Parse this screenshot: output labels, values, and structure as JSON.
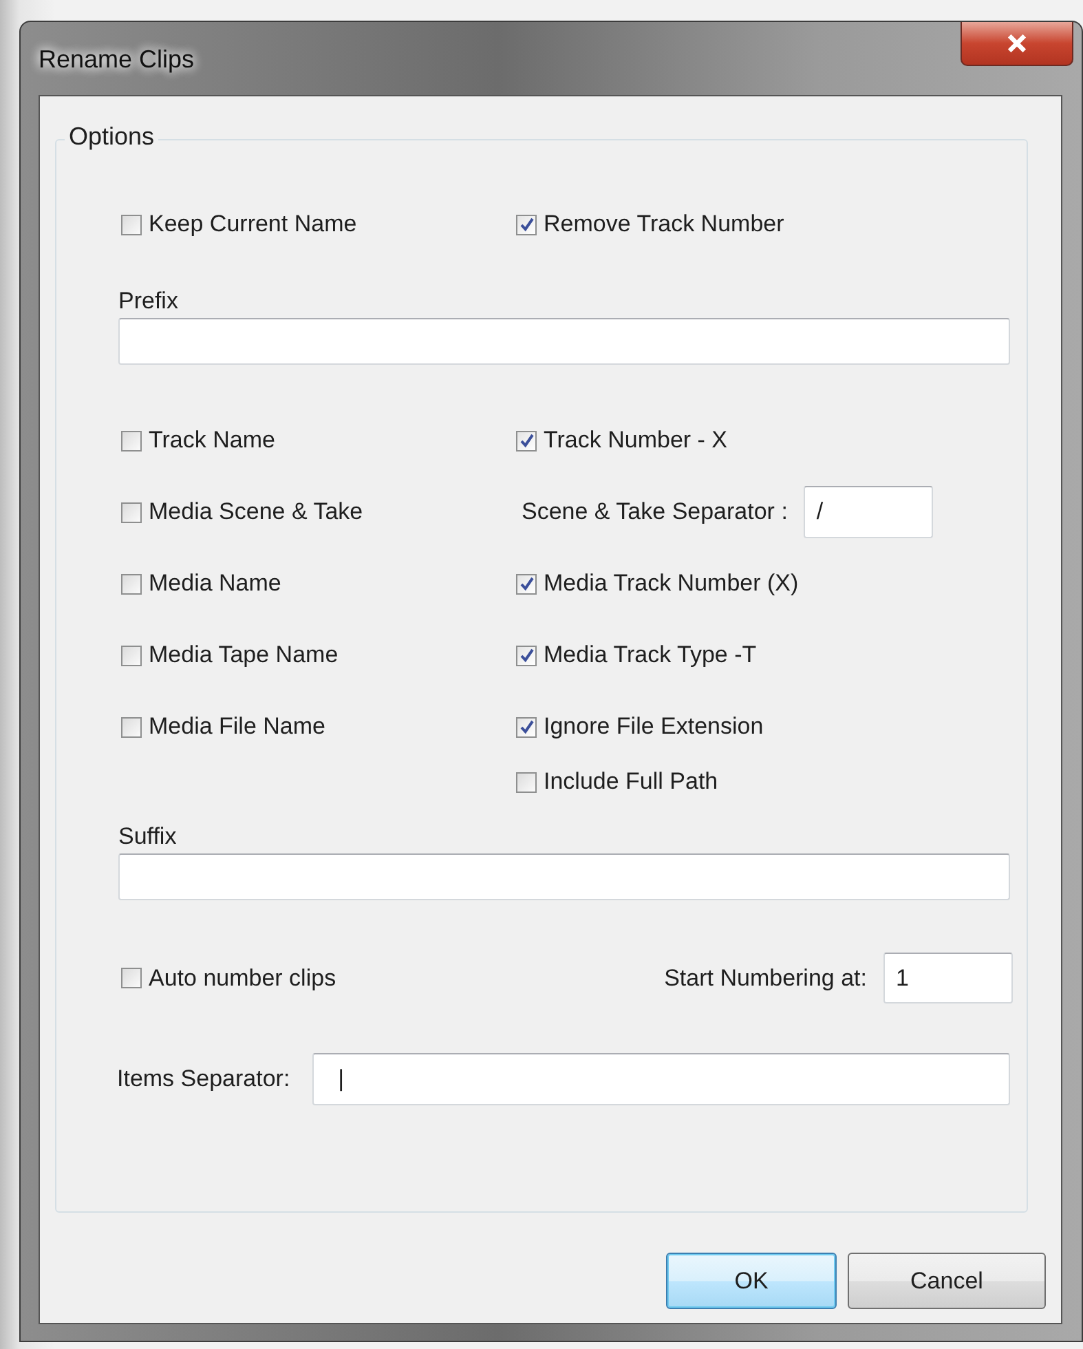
{
  "window": {
    "title": "Rename Clips"
  },
  "options": {
    "legend": "Options",
    "top_checkboxes": [
      {
        "label": "Keep Current Name",
        "checked": false
      },
      {
        "label": "Remove Track Number",
        "checked": true
      }
    ],
    "prefix": {
      "label": "Prefix"
    },
    "left_checkboxes": [
      {
        "label": "Track Name",
        "checked": false
      },
      {
        "label": "Media Scene & Take",
        "checked": false
      },
      {
        "label": "Media Name",
        "checked": false
      },
      {
        "label": "Media Tape Name",
        "checked": false
      },
      {
        "label": "Media File Name",
        "checked": false
      }
    ],
    "right_items": [
      {
        "kind": "checkbox",
        "label": "Track Number - X",
        "checked": true
      },
      {
        "kind": "field",
        "label": "Scene & Take Separator :",
        "value": "/"
      },
      {
        "kind": "checkbox",
        "label": "Media Track Number (X)",
        "checked": true
      },
      {
        "kind": "checkbox",
        "label": "Media Track Type -T",
        "checked": true
      },
      {
        "kind": "checkbox",
        "label": "Ignore File Extension",
        "checked": true
      },
      {
        "kind": "checkbox",
        "label": "Include Full Path",
        "checked": false
      }
    ],
    "suffix": {
      "label": "Suffix"
    },
    "auto_number": {
      "label": "Auto number clips",
      "checked": false
    },
    "start_numbering": {
      "label": "Start Numbering at:",
      "value": "1"
    },
    "items_separator": {
      "label": "Items Separator:",
      "value": "|"
    }
  },
  "buttons": [
    {
      "label": "OK",
      "default": true
    },
    {
      "label": "Cancel",
      "default": false
    }
  ]
}
